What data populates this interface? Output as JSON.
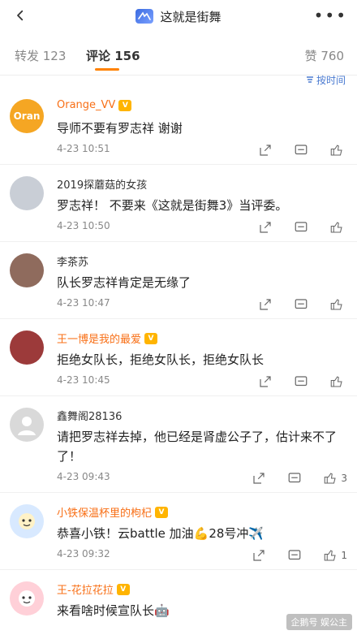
{
  "header": {
    "title": "这就是街舞",
    "back_icon": "arrow-left-icon",
    "more_icon": "more-horizontal-icon"
  },
  "tabs": {
    "repost": "转发 123",
    "comments": "评论 156",
    "likes": "赞 760",
    "active": "comments"
  },
  "sort": {
    "label": "按时间"
  },
  "comments": [
    {
      "username": "Orange_VV",
      "vip": true,
      "content": "导师不要有罗志祥 谢谢",
      "time": "4-23 10:51",
      "likes": ""
    },
    {
      "username": "2019探蘑菇的女孩",
      "vip": false,
      "content": "罗志祥！ 不要来《这就是街舞3》当评委。",
      "time": "4-23 10:50",
      "likes": ""
    },
    {
      "username": "李茶苏",
      "vip": false,
      "content": "队长罗志祥肯定是无缘了",
      "time": "4-23 10:47",
      "likes": ""
    },
    {
      "username": "王一博是我的最爱",
      "vip": true,
      "content": "拒绝女队长，拒绝女队长，拒绝女队长",
      "time": "4-23 10:45",
      "likes": ""
    },
    {
      "username": "鑫舞阁28136",
      "vip": false,
      "content": "请把罗志祥去掉，他已经是肾虚公子了，估计来不了了！",
      "time": "4-23 09:43",
      "likes": "3"
    },
    {
      "username": "小铁保温杯里的枸杞",
      "vip": true,
      "content": "恭喜小铁！云battle 加油💪28号冲✈️",
      "time": "4-23 09:32",
      "likes": "1"
    },
    {
      "username": "王-花拉花拉",
      "vip": true,
      "content": "来看啥时候宣队长🤖",
      "time": "",
      "likes": ""
    }
  ],
  "avatars": [
    {
      "label": "Oran",
      "color": "#f5a623"
    },
    {
      "label": "",
      "color": "#c9ced6"
    },
    {
      "label": "",
      "color": "#8f6b5d"
    },
    {
      "label": "",
      "color": "#9c3a3a"
    },
    {
      "label": "",
      "color": "#d9d9d9"
    },
    {
      "label": "",
      "color": "#d8e9ff"
    },
    {
      "label": "",
      "color": "#ffd0d8"
    }
  ],
  "watermark": "企鹅号 娱公主"
}
